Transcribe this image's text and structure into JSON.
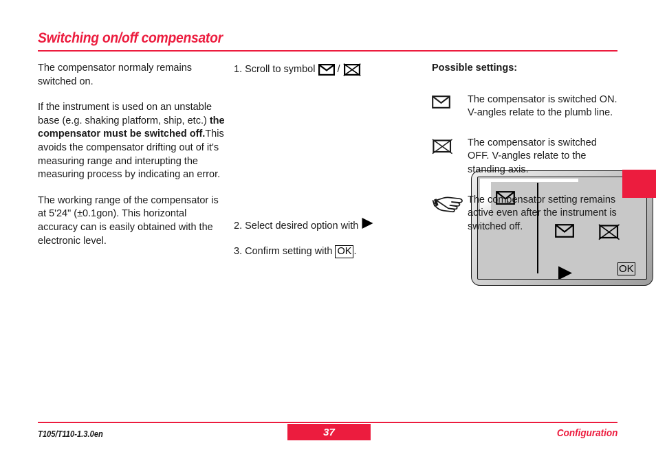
{
  "header": {
    "title": "Switching on/off compensator"
  },
  "left_column": {
    "paragraphs": [
      {
        "id": "p1",
        "text": "The compensator normaly remains switched on."
      },
      {
        "id": "p2a",
        "text": "If the instrument is used on an unstable base (e.g. shaking platform, ship, etc.) "
      },
      {
        "id": "p2b_bold",
        "text": "the compensator must be switched off."
      },
      {
        "id": "p2c",
        "text": "This avoids the compensator drifting out of it's measuring range and interupting the measuring process by indicating an error."
      },
      {
        "id": "p3",
        "text": "The working range of the compensator is at 5'24\" (±0.1gon). This horizontal accuracy can is easily obtained with the electronic level."
      }
    ]
  },
  "middle_column": {
    "steps": [
      {
        "number": "1.",
        "text": "Scroll to symbol ",
        "separator": " / ",
        "icon_on": "compensator-on-icon",
        "icon_off": "compensator-off-icon"
      },
      {
        "number": "2.",
        "text": "Select desired option with ",
        "icon": "play-triangle-icon"
      },
      {
        "number": "3.",
        "text": "Confirm setting with ",
        "key_label": "OK",
        "suffix": "."
      }
    ],
    "device": {
      "status_icon": "compensator-on-icon",
      "option_on_icon": "compensator-on-icon",
      "option_off_icon": "compensator-off-icon",
      "play_icon": "play-triangle-icon",
      "ok_key_label": "OK"
    }
  },
  "right_column": {
    "heading": "Possible settings:",
    "settings": [
      {
        "icon": "compensator-on-icon",
        "text": "The compensator is switched ON. V-angles relate to the plumb line."
      },
      {
        "icon": "compensator-off-icon",
        "text": "The compensator is switched OFF. V-angles relate to the standing axis."
      },
      {
        "icon": "pointing-hand-icon",
        "text": "The compensator setting remains active even after the instrument is switched off."
      }
    ]
  },
  "footer": {
    "document_code": "T105/T110-1.3.0en",
    "page_number": "37",
    "section": "Configuration"
  },
  "colors": {
    "accent_red": "#ec1c3e",
    "text_black": "#1a1a1a",
    "screen_gray": "#c8c8c8"
  }
}
